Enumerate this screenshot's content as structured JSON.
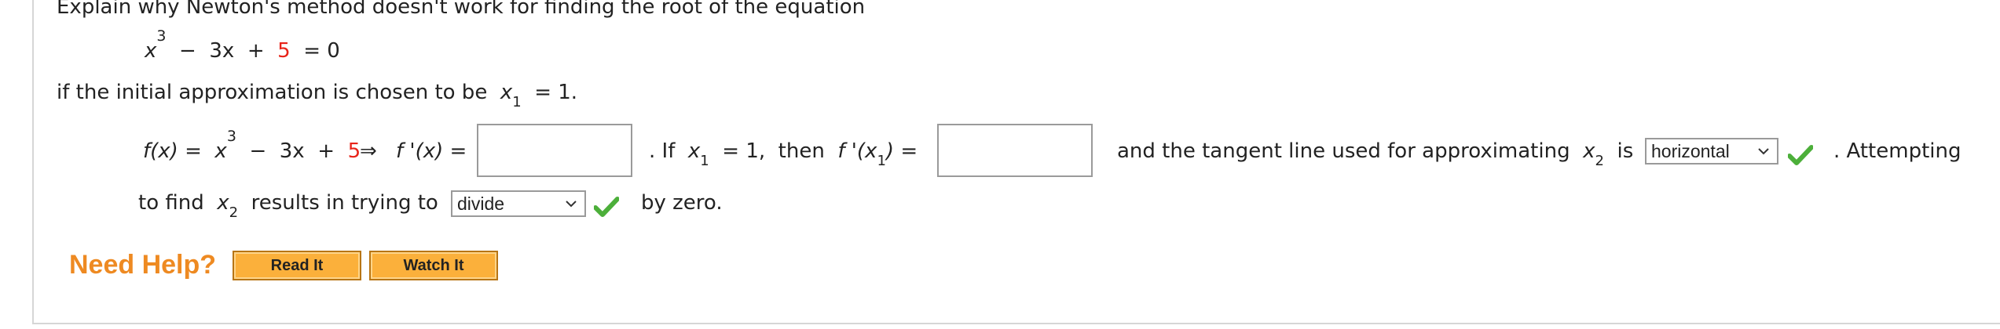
{
  "question": {
    "prompt": "Explain why Newton's method doesn't work for finding the root of the equation",
    "equation": {
      "x": "x",
      "exp": "3",
      "minus": "−",
      "term": "3x",
      "plus": "+",
      "constant": "5",
      "equals": "= 0"
    },
    "condition": "if the initial approximation is chosen to be",
    "x1_var": "x",
    "x1_sub": "1",
    "x1_value": "= 1."
  },
  "work": {
    "fx_label": "f(x) =",
    "fx_x": "x",
    "fx_exp": "3",
    "fx_minus": "−",
    "fx_term": "3x",
    "fx_plus": "+",
    "fx_constant": "5",
    "implies": "⇒",
    "fprime_label": "f '(x) =",
    "fprime_value": "",
    "if_text": ". If",
    "if_var": "x",
    "if_sub": "1",
    "if_value": "= 1,",
    "then_text": "then",
    "fprime_x1_label": "f '(x",
    "fprime_x1_sub": "1",
    "fprime_x1_close": ") =",
    "fprime_x1_value": "",
    "tangent_text": "and the tangent line used for approximating",
    "tangent_var": "x",
    "tangent_sub": "2",
    "is_text": "is",
    "tangent_select": "horizontal",
    "attempting_text": ". Attempting",
    "find_text": "to find",
    "find_var": "x",
    "find_sub": "2",
    "results_text": "results in trying to",
    "action_select": "divide",
    "by_zero_text": "by zero."
  },
  "help": {
    "label": "Need Help?",
    "read_button": "Read It",
    "watch_button": "Watch It"
  },
  "colors": {
    "accent_red": "#e8241a",
    "help_orange": "#ee8a22",
    "button_fill": "#fbb03b",
    "check_green": "#4caf3a"
  }
}
